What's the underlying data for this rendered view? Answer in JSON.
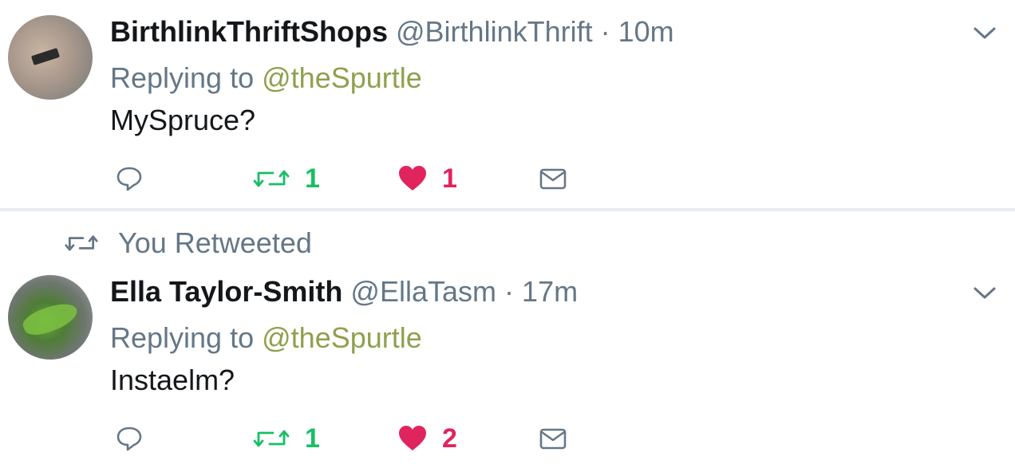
{
  "colors": {
    "text": "#14171a",
    "secondary": "#657786",
    "mention": "#8fa04d",
    "retweet": "#17bf63",
    "like": "#e0245e",
    "divider": "#e6ecf0"
  },
  "tweets": [
    {
      "display_name": "BirthlinkThriftShops",
      "handle": "@BirthlinkThrift",
      "separator": "·",
      "time": "10m",
      "replying_prefix": "Replying to",
      "replying_to": "@theSpurtle",
      "text": "MySpruce?",
      "retweet_count": "1",
      "like_count": "1",
      "icons": [
        "reply-icon",
        "retweet-icon",
        "heart-icon",
        "mail-icon",
        "chevron-down-icon"
      ]
    },
    {
      "retweet_banner": "You Retweeted",
      "display_name": "Ella Taylor-Smith",
      "handle": "@EllaTasm",
      "separator": "·",
      "time": "17m",
      "replying_prefix": "Replying to",
      "replying_to": "@theSpurtle",
      "text": "Instaelm?",
      "retweet_count": "1",
      "like_count": "2",
      "icons": [
        "reply-icon",
        "retweet-icon",
        "heart-icon",
        "mail-icon",
        "chevron-down-icon"
      ]
    }
  ]
}
